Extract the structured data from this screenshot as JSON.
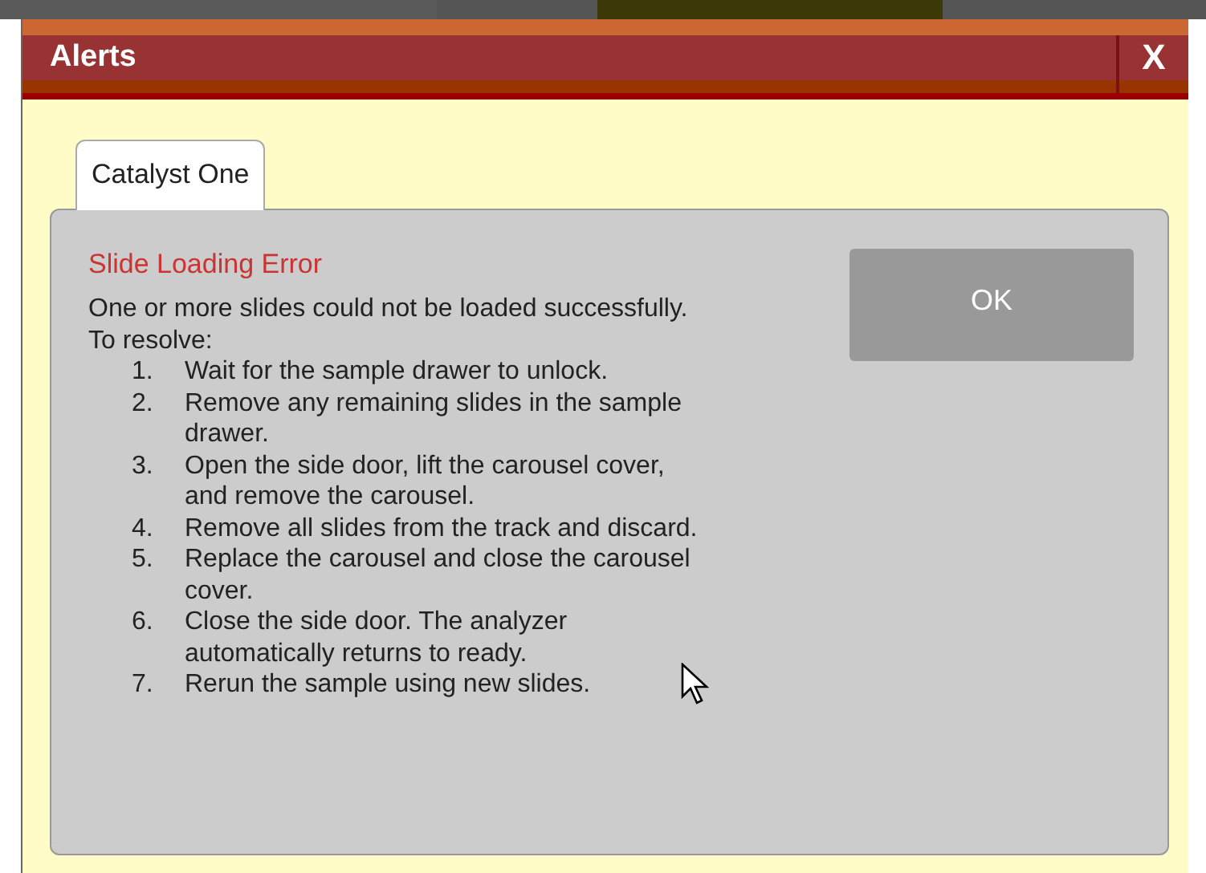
{
  "window": {
    "title": "Alerts",
    "close": "X"
  },
  "tabs": [
    {
      "label": "Catalyst One",
      "selected": true
    }
  ],
  "alert": {
    "title": "Slide Loading Error",
    "message": "One or more slides could not be loaded successfully.",
    "intro": "To resolve:",
    "steps": [
      {
        "number": "1.",
        "text": "Wait for the sample drawer to unlock."
      },
      {
        "number": "2.",
        "text": "Remove any remaining slides in the sample drawer."
      },
      {
        "number": "3.",
        "text": "Open the side door, lift the carousel cover, and remove the carousel."
      },
      {
        "number": "4.",
        "text": "Remove all slides from the track and discard."
      },
      {
        "number": "5.",
        "text": "Replace the carousel and close the carousel cover."
      },
      {
        "number": "6.",
        "text": "Close the side door. The analyzer automatically returns to ready."
      },
      {
        "number": "7.",
        "text": "Rerun the sample using new slides."
      }
    ]
  },
  "buttons": [
    {
      "label": "OK"
    }
  ]
}
